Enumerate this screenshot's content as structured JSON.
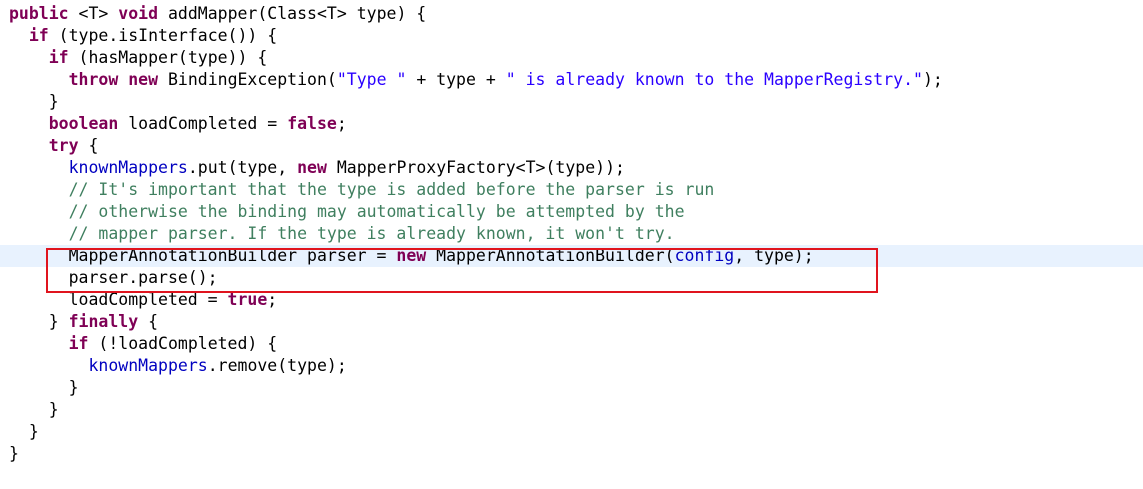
{
  "editor": {
    "lines": [
      [
        {
          "t": "public",
          "c": "kw"
        },
        {
          "t": " <T> ",
          "c": ""
        },
        {
          "t": "void",
          "c": "kw"
        },
        {
          "t": " addMapper(Class<T> type) {",
          "c": ""
        }
      ],
      [
        {
          "t": "  ",
          "c": ""
        },
        {
          "t": "if",
          "c": "kw"
        },
        {
          "t": " (type.isInterface()) {",
          "c": ""
        }
      ],
      [
        {
          "t": "    ",
          "c": ""
        },
        {
          "t": "if",
          "c": "kw"
        },
        {
          "t": " (hasMapper(type)) {",
          "c": ""
        }
      ],
      [
        {
          "t": "      ",
          "c": ""
        },
        {
          "t": "throw",
          "c": "kw"
        },
        {
          "t": " ",
          "c": ""
        },
        {
          "t": "new",
          "c": "kw"
        },
        {
          "t": " BindingException(",
          "c": ""
        },
        {
          "t": "\"Type \"",
          "c": "str"
        },
        {
          "t": " + type + ",
          "c": ""
        },
        {
          "t": "\" is already known to the MapperRegistry.\"",
          "c": "str"
        },
        {
          "t": ");",
          "c": ""
        }
      ],
      [
        {
          "t": "    }",
          "c": ""
        }
      ],
      [
        {
          "t": "    ",
          "c": ""
        },
        {
          "t": "boolean",
          "c": "kw"
        },
        {
          "t": " loadCompleted = ",
          "c": ""
        },
        {
          "t": "false",
          "c": "kw"
        },
        {
          "t": ";",
          "c": ""
        }
      ],
      [
        {
          "t": "    ",
          "c": ""
        },
        {
          "t": "try",
          "c": "kw"
        },
        {
          "t": " {",
          "c": ""
        }
      ],
      [
        {
          "t": "      ",
          "c": ""
        },
        {
          "t": "knownMappers",
          "c": "fld"
        },
        {
          "t": ".put(type, ",
          "c": ""
        },
        {
          "t": "new",
          "c": "kw"
        },
        {
          "t": " MapperProxyFactory<T>(type));",
          "c": ""
        }
      ],
      [
        {
          "t": "      ",
          "c": ""
        },
        {
          "t": "// It's important that the type is added before the parser is run",
          "c": "cm"
        }
      ],
      [
        {
          "t": "      ",
          "c": ""
        },
        {
          "t": "// otherwise the binding may automatically be attempted by the",
          "c": "cm"
        }
      ],
      [
        {
          "t": "      ",
          "c": ""
        },
        {
          "t": "// mapper parser. If the type is already known, it won't try.",
          "c": "cm"
        }
      ],
      [
        {
          "t": "      MapperAnnotationBuilder parser = ",
          "c": ""
        },
        {
          "t": "new",
          "c": "kw"
        },
        {
          "t": " MapperAnnotationBuilder(",
          "c": ""
        },
        {
          "t": "config",
          "c": "fld"
        },
        {
          "t": ", type);",
          "c": ""
        }
      ],
      [
        {
          "t": "      parser.parse();",
          "c": ""
        }
      ],
      [
        {
          "t": "      loadCompleted = ",
          "c": ""
        },
        {
          "t": "true",
          "c": "kw"
        },
        {
          "t": ";",
          "c": ""
        }
      ],
      [
        {
          "t": "    } ",
          "c": ""
        },
        {
          "t": "finally",
          "c": "kw"
        },
        {
          "t": " {",
          "c": ""
        }
      ],
      [
        {
          "t": "      ",
          "c": ""
        },
        {
          "t": "if",
          "c": "kw"
        },
        {
          "t": " (!loadCompleted) {",
          "c": ""
        }
      ],
      [
        {
          "t": "        ",
          "c": ""
        },
        {
          "t": "knownMappers",
          "c": "fld"
        },
        {
          "t": ".remove(type);",
          "c": ""
        }
      ],
      [
        {
          "t": "      }",
          "c": ""
        }
      ],
      [
        {
          "t": "    }",
          "c": ""
        }
      ],
      [
        {
          "t": "  }",
          "c": ""
        }
      ],
      [
        {
          "t": "}",
          "c": ""
        }
      ]
    ],
    "current_line": 11,
    "highlighted_lines": [
      11,
      12
    ]
  },
  "colors": {
    "keyword": "#7f0055",
    "comment": "#3f7f5f",
    "string": "#2a00ff",
    "field": "#0000c0",
    "current_line_bg": "#e8f2fe",
    "highlight_border": "#e0141e"
  }
}
